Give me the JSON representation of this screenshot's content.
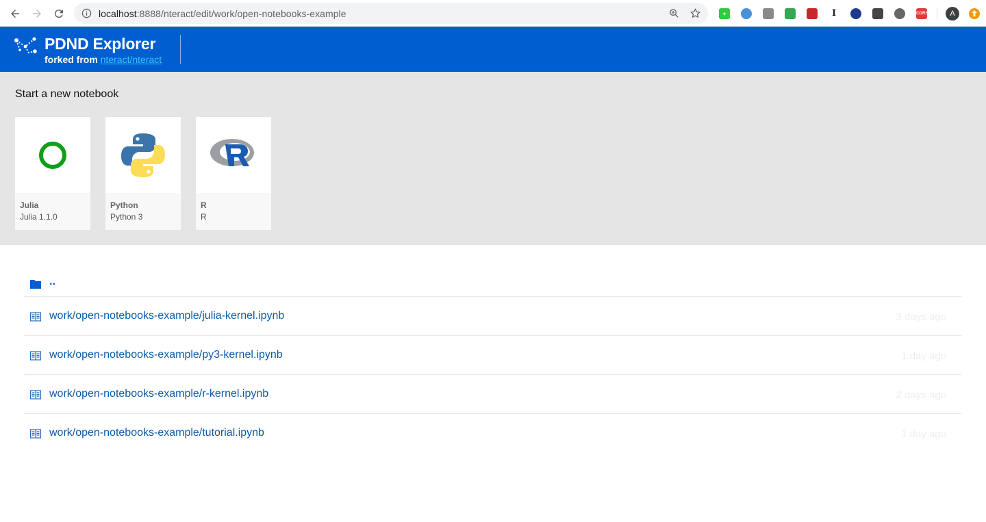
{
  "browser": {
    "url_host": "localhost",
    "url_path": ":8888/nteract/edit/work/open-notebooks-example",
    "profile_initial": "A",
    "extensions": [
      {
        "name": "green-plus-extension-icon",
        "color": "#2ecc40",
        "glyph": "+"
      },
      {
        "name": "blue-circle-extension-icon",
        "color": "#4a90d9",
        "glyph": ""
      },
      {
        "name": "cube-extension-icon",
        "color": "#8a8a8a",
        "glyph": ""
      },
      {
        "name": "cloud-extension-icon",
        "color": "#34a853",
        "glyph": ""
      },
      {
        "name": "red-grid-extension-icon",
        "color": "#c62828",
        "glyph": ""
      },
      {
        "name": "text-cursor-extension-icon",
        "color": "#ffffff",
        "glyph": "I"
      },
      {
        "name": "globe-extension-icon",
        "color": "#1e3a8a",
        "glyph": ""
      },
      {
        "name": "mask-extension-icon",
        "color": "#444444",
        "glyph": ""
      },
      {
        "name": "ring-extension-icon",
        "color": "#666666",
        "glyph": ""
      },
      {
        "name": "cors-extension-icon",
        "color": "#e53935",
        "glyph": "CORS"
      }
    ]
  },
  "header": {
    "title": "PDND Explorer",
    "forked_prefix": "forked from ",
    "forked_link": "nteract/nteract"
  },
  "kernels": {
    "section_title": "Start a new notebook",
    "items": [
      {
        "name": "Julia",
        "version": "Julia 1.1.0"
      },
      {
        "name": "Python",
        "version": "Python 3"
      },
      {
        "name": "R",
        "version": "R"
      }
    ]
  },
  "files": {
    "parent_label": "..",
    "items": [
      {
        "name": "work/open-notebooks-example/julia-kernel.ipynb",
        "modified": "3 days ago"
      },
      {
        "name": "work/open-notebooks-example/py3-kernel.ipynb",
        "modified": "1 day ago"
      },
      {
        "name": "work/open-notebooks-example/r-kernel.ipynb",
        "modified": "2 days ago"
      },
      {
        "name": "work/open-notebooks-example/tutorial.ipynb",
        "modified": "1 day ago"
      }
    ]
  }
}
